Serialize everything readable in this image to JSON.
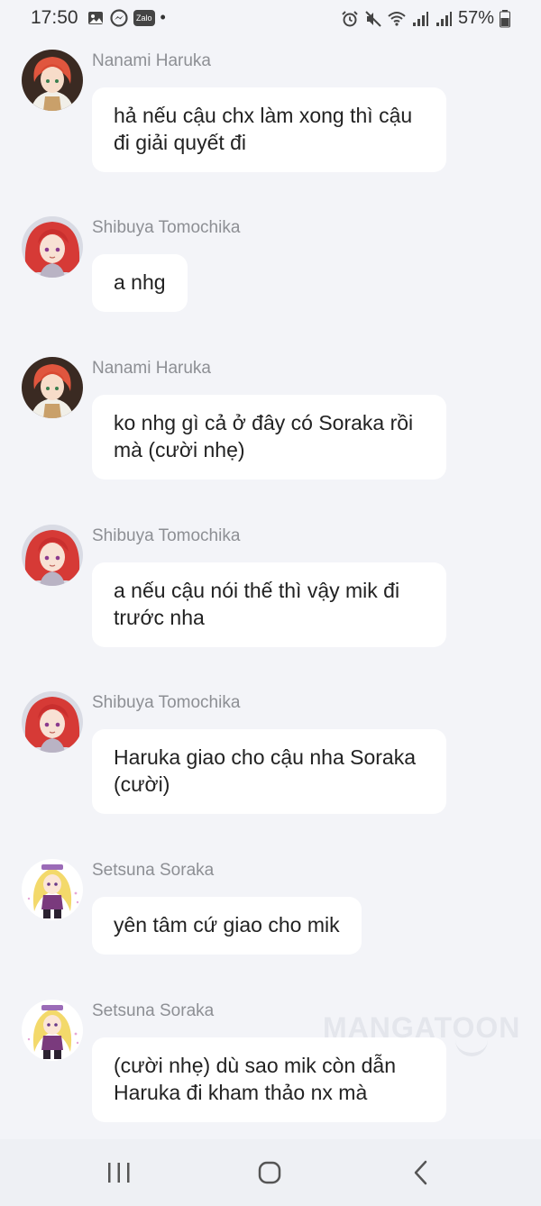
{
  "status_bar": {
    "time": "17:50",
    "left_icons": [
      "gallery-icon",
      "messenger-icon",
      "zalo-icon",
      "notification-dot-icon"
    ],
    "zalo_label": "Zalo",
    "dot": "•",
    "right_icons": [
      "alarm-icon",
      "mute-icon",
      "wifi-icon",
      "signal-icon",
      "signal-icon",
      "battery-icon"
    ],
    "battery": "57%"
  },
  "messages": [
    {
      "sender": "Nanami Haruka",
      "avatar": "avatar-nanami",
      "text": "hả nếu cậu chx làm xong thì cậu đi giải quyết đi"
    },
    {
      "sender": "Shibuya Tomochika",
      "avatar": "avatar-shibuya",
      "text": "a nhg"
    },
    {
      "sender": "Nanami Haruka",
      "avatar": "avatar-nanami",
      "text": "ko nhg gì cả ở đây có Soraka rồi mà (cười nhẹ)"
    },
    {
      "sender": "Shibuya Tomochika",
      "avatar": "avatar-shibuya",
      "text": "a nếu cậu nói thế thì vậy mik đi trước nha"
    },
    {
      "sender": "Shibuya Tomochika",
      "avatar": "avatar-shibuya",
      "text": "Haruka giao cho cậu nha Soraka (cười)"
    },
    {
      "sender": "Setsuna Soraka",
      "avatar": "avatar-setsuna",
      "text": "yên tâm cứ giao cho mik"
    },
    {
      "sender": "Setsuna Soraka",
      "avatar": "avatar-setsuna",
      "text": "(cười nhẹ) dù sao mik còn dẫn Haruka đi kham thảo nx mà"
    }
  ],
  "watermark": "MANGATOON",
  "nav_bar": {
    "buttons": [
      "recent-apps-icon",
      "home-icon",
      "back-icon"
    ]
  },
  "colors": {
    "background": "#f3f4f8",
    "bubble": "#ffffff",
    "sender": "#8d8f94",
    "text": "#222222",
    "nav": "#eef0f4"
  }
}
